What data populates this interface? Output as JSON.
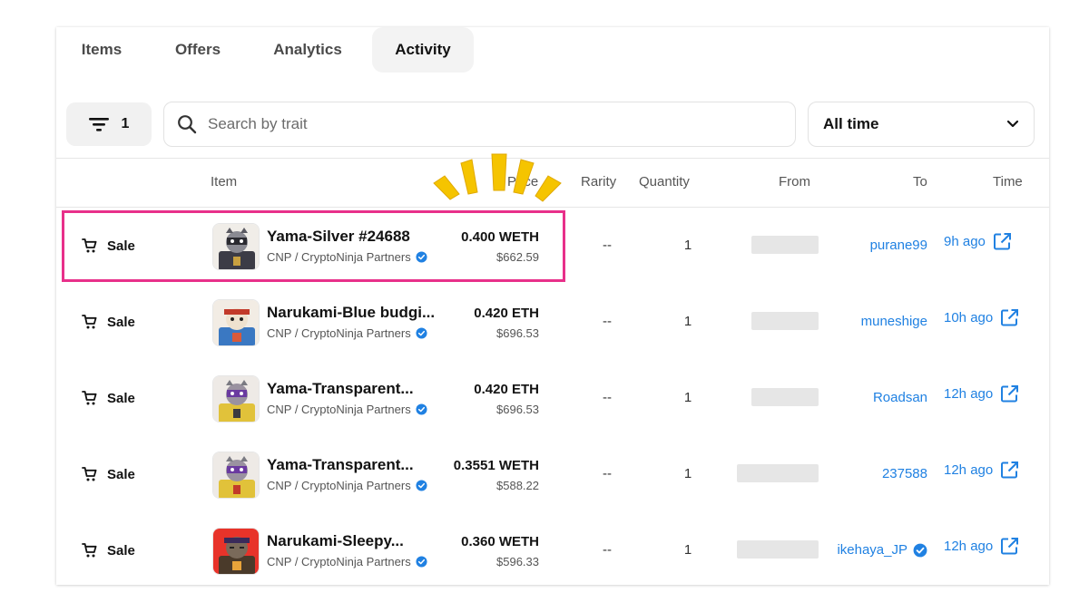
{
  "tabs": [
    {
      "label": "Items",
      "active": false
    },
    {
      "label": "Offers",
      "active": false
    },
    {
      "label": "Analytics",
      "active": false
    },
    {
      "label": "Activity",
      "active": true
    }
  ],
  "filter": {
    "icon": "filter-lines-icon",
    "count": "1"
  },
  "search": {
    "placeholder": "Search by trait",
    "value": "",
    "icon": "search-icon"
  },
  "time_filter": {
    "selected": "All time",
    "icon": "chevron-down-icon"
  },
  "table": {
    "headers": {
      "item": "Item",
      "price": "Price",
      "rarity": "Rarity",
      "quantity": "Quantity",
      "from": "From",
      "to": "To",
      "time": "Time"
    },
    "rows": [
      {
        "event": "Sale",
        "name": "Yama-Silver #24688",
        "collection": "CNP / CryptoNinja Partners",
        "price": "0.400 WETH",
        "usd": "$662.59",
        "rarity": "--",
        "quantity": "1",
        "to": "purane99",
        "to_verified": false,
        "time": "9h ago"
      },
      {
        "event": "Sale",
        "name": "Narukami-Blue budgi...",
        "collection": "CNP / CryptoNinja Partners",
        "price": "0.420 ETH",
        "usd": "$696.53",
        "rarity": "--",
        "quantity": "1",
        "to": "muneshige",
        "to_verified": false,
        "time": "10h ago"
      },
      {
        "event": "Sale",
        "name": "Yama-Transparent...",
        "collection": "CNP / CryptoNinja Partners",
        "price": "0.420 ETH",
        "usd": "$696.53",
        "rarity": "--",
        "quantity": "1",
        "to": "Roadsan",
        "to_verified": false,
        "time": "12h ago"
      },
      {
        "event": "Sale",
        "name": "Yama-Transparent...",
        "collection": "CNP / CryptoNinja Partners",
        "price": "0.3551 WETH",
        "usd": "$588.22",
        "rarity": "--",
        "quantity": "1",
        "to": "237588",
        "to_verified": false,
        "time": "12h ago"
      },
      {
        "event": "Sale",
        "name": "Narukami-Sleepy...",
        "collection": "CNP / CryptoNinja Partners",
        "price": "0.360 WETH",
        "usd": "$596.33",
        "rarity": "--",
        "quantity": "1",
        "to": "ikehaya_JP",
        "to_verified": true,
        "time": "12h ago"
      }
    ]
  },
  "colors": {
    "link": "#2081e2",
    "highlight": "#e8308a",
    "verified": "#2081e2",
    "burst": "#f5c400"
  }
}
